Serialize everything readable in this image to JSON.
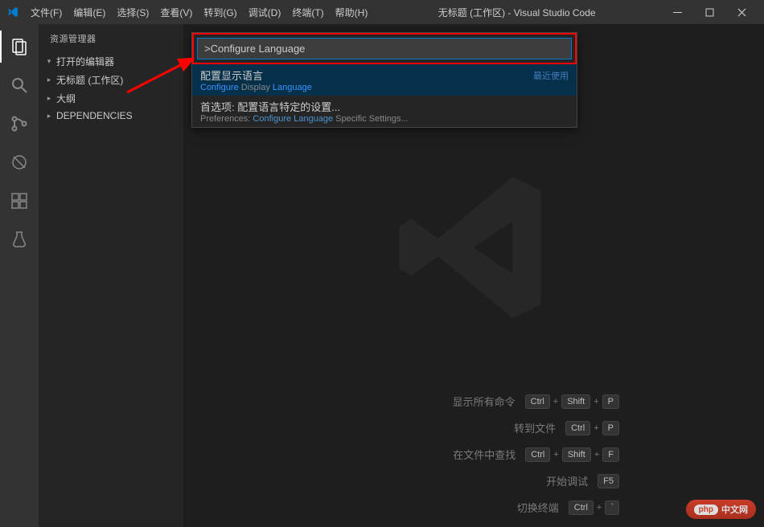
{
  "menubar": {
    "file": "文件(F)",
    "edit": "编辑(E)",
    "select": "选择(S)",
    "view": "查看(V)",
    "goto": "转到(G)",
    "debug": "调试(D)",
    "terminal": "终端(T)",
    "help": "帮助(H)"
  },
  "window_title": "无标题 (工作区) - Visual Studio Code",
  "sidebar": {
    "header": "资源管理器",
    "items": [
      {
        "label": "打开的编辑器",
        "expanded": true
      },
      {
        "label": "无标题 (工作区)",
        "expanded": false
      },
      {
        "label": "大纲",
        "expanded": false
      },
      {
        "label": "DEPENDENCIES",
        "expanded": false
      }
    ]
  },
  "palette": {
    "input_value": ">Configure Language",
    "items": [
      {
        "title_prefix": "配置显示语言",
        "subtitle_prefix": "Configure",
        "subtitle_mid": " Display ",
        "subtitle_suffix": "Language",
        "hint": "最近使用",
        "selected": true
      },
      {
        "title_prefix": "首选项: 配置语言特定的设置...",
        "subtitle_prefix": "Preferences: ",
        "subtitle_hl1": "Configure Language",
        "subtitle_suffix": " Specific Settings...",
        "hint": "",
        "selected": false
      }
    ]
  },
  "shortcuts": {
    "rows": [
      {
        "label": "显示所有命令",
        "keys": [
          "Ctrl",
          "Shift",
          "P"
        ]
      },
      {
        "label": "转到文件",
        "keys": [
          "Ctrl",
          "P"
        ]
      },
      {
        "label": "在文件中查找",
        "keys": [
          "Ctrl",
          "Shift",
          "F"
        ]
      },
      {
        "label": "开始调试",
        "keys": [
          "F5"
        ]
      },
      {
        "label": "切换终端",
        "keys": [
          "Ctrl",
          "`"
        ]
      }
    ]
  },
  "watermark_badge": {
    "logo": "php",
    "text": "中文网"
  }
}
